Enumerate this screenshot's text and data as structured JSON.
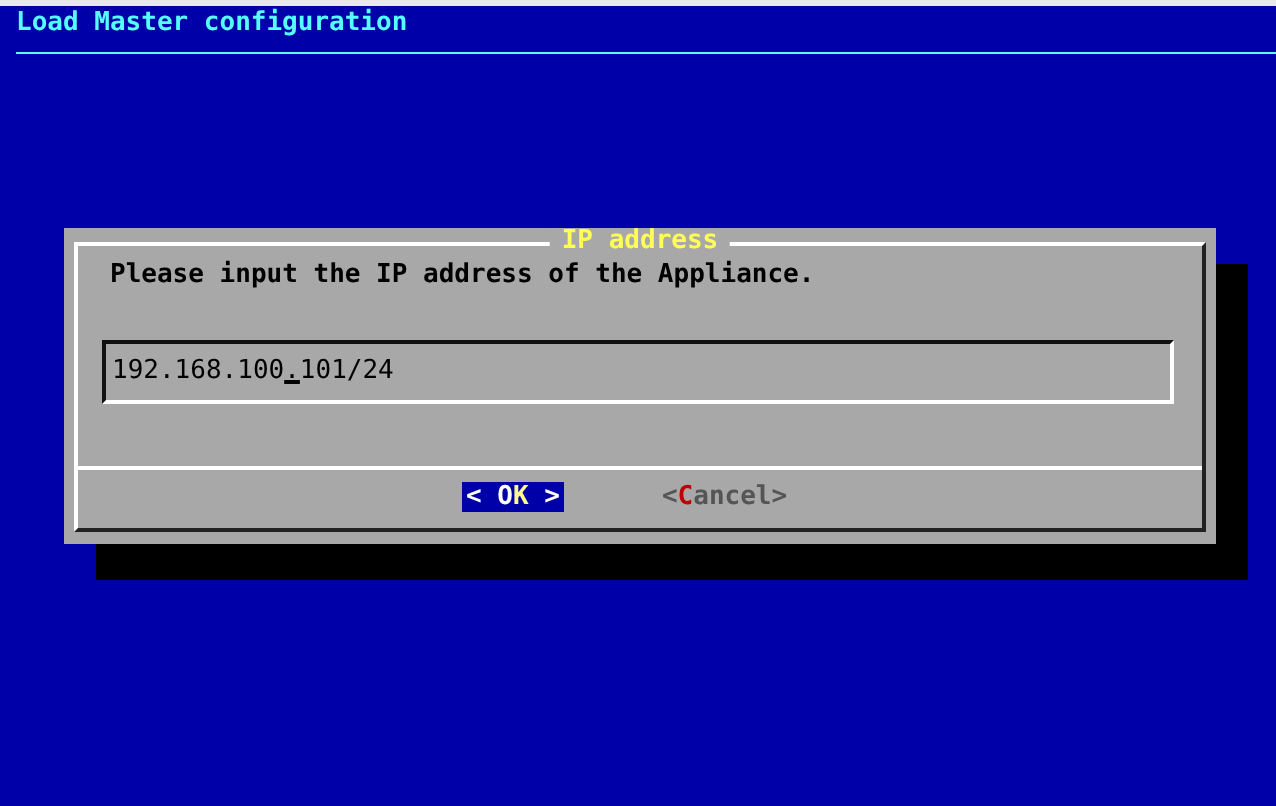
{
  "backtitle": "Load Master configuration",
  "dialog": {
    "title": "IP address",
    "message": "Please input the IP address of the Appliance.",
    "input": {
      "before_cursor": "192.168.100",
      "at_cursor": ".",
      "after_cursor": "101/24"
    },
    "buttons": [
      {
        "left": "<",
        "right": ">",
        "selected": true,
        "parts": [
          {
            "text": "O",
            "hotkey": false
          },
          {
            "text": "K",
            "hotkey": true
          }
        ]
      },
      {
        "left": "<",
        "right": ">",
        "selected": false,
        "parts": [
          {
            "text": "C",
            "hotkey": true
          },
          {
            "text": "ancel",
            "hotkey": false
          }
        ]
      }
    ]
  }
}
